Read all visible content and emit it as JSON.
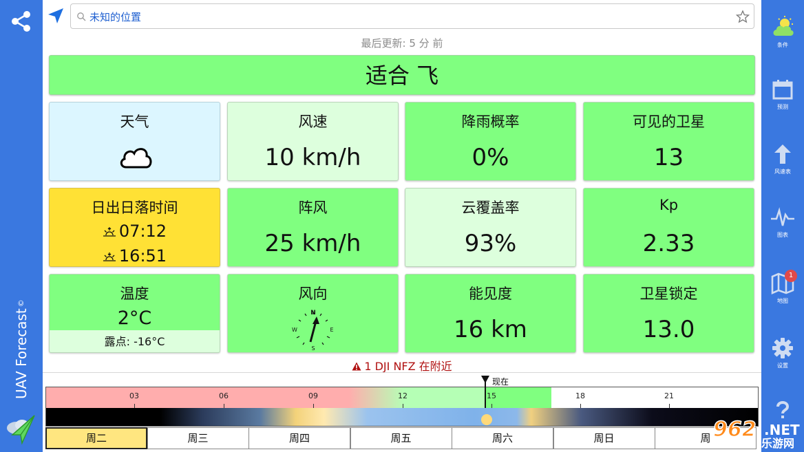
{
  "search": {
    "value": "未知的位置"
  },
  "last_update": "最后更新: 5 分 前",
  "verdict": "适合 飞",
  "cards": {
    "weather": {
      "title": "天气"
    },
    "wind_speed": {
      "title": "风速",
      "value": "10 km/h"
    },
    "rain": {
      "title": "降雨概率",
      "value": "0%"
    },
    "satellites": {
      "title": "可见的卫星",
      "value": "13"
    },
    "sun": {
      "title": "日出日落时间",
      "sunrise": "07:12",
      "sunset": "16:51"
    },
    "gust": {
      "title": "阵风",
      "value": "25 km/h"
    },
    "cloud": {
      "title": "云覆盖率",
      "value": "93%"
    },
    "kp": {
      "title": "Kp",
      "value": "2.33"
    },
    "temp": {
      "title": "温度",
      "value": "2°C",
      "dew": "露点: -16°C"
    },
    "wind_dir": {
      "title": "风向",
      "n": "N",
      "e": "E",
      "s": "S",
      "w": "W"
    },
    "visibility": {
      "title": "能见度",
      "value": "16 km"
    },
    "sat_lock": {
      "title": "卫星锁定",
      "value": "13.0"
    }
  },
  "nfz": "1 DJI NFZ 在附近",
  "timeline": {
    "now": "现在",
    "hours": [
      "03",
      "06",
      "09",
      "12",
      "15",
      "18",
      "21"
    ]
  },
  "days": [
    "周二",
    "周三",
    "周四",
    "周五",
    "周六",
    "周日",
    "周"
  ],
  "brand": {
    "name": "UAV Forecast",
    "copyright": "©"
  },
  "right_nav": {
    "conditions": "条件",
    "forecast": "预测",
    "wind": "风速表",
    "charts": "图表",
    "map": "地图",
    "map_badge": "1",
    "settings": "设置"
  },
  "watermark": {
    "number": "962",
    "tld": ".NET",
    "site": "乐游网"
  },
  "colors": {
    "rail": "#3a78e0",
    "good": "#80ff80",
    "pale_good": "#ddffdd",
    "sun": "#ffe135",
    "weather": "#dcf6ff",
    "warn": "#b01010"
  }
}
